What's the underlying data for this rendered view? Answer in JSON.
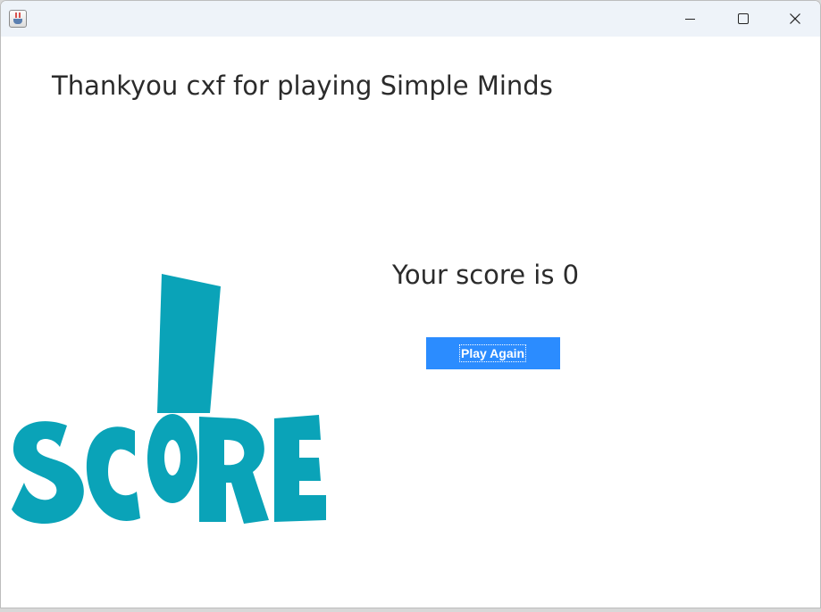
{
  "window": {
    "title": "",
    "app_icon": "java-cup-icon",
    "controls": [
      "minimize-icon",
      "maximize-icon",
      "close-icon"
    ]
  },
  "content": {
    "thank_you_message": "Thankyou cxf for playing Simple Minds",
    "score_message": "Your score is 0",
    "play_again_label": "Play Again",
    "logo_text": "SCORE"
  },
  "colors": {
    "button_bg": "#2b8cff",
    "logo_teal": "#0aa3b8",
    "titlebar_bg": "#eef3f9"
  }
}
